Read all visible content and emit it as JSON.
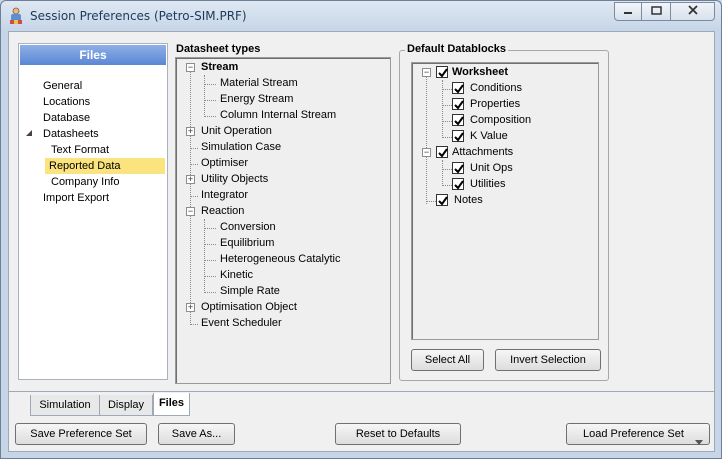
{
  "window": {
    "title": "Session Preferences (Petro-SIM.PRF)"
  },
  "nav": {
    "header": "Files",
    "items": [
      {
        "label": "General",
        "selected": false
      },
      {
        "label": "Locations",
        "selected": false
      },
      {
        "label": "Database",
        "selected": false
      },
      {
        "label": "Datasheets",
        "selected": false
      },
      {
        "label": "Text Format",
        "selected": false
      },
      {
        "label": "Reported Data",
        "selected": true
      },
      {
        "label": "Company Info",
        "selected": false
      },
      {
        "label": "Import Export",
        "selected": false
      }
    ]
  },
  "datasheet_types": {
    "label": "Datasheet types",
    "items": [
      {
        "label": "Stream",
        "bold": true,
        "expander": "−"
      },
      {
        "label": "Material Stream"
      },
      {
        "label": "Energy Stream"
      },
      {
        "label": "Column Internal Stream"
      },
      {
        "label": "Unit Operation",
        "expander": "+"
      },
      {
        "label": "Simulation Case"
      },
      {
        "label": "Optimiser"
      },
      {
        "label": "Utility Objects",
        "expander": "+"
      },
      {
        "label": "Integrator"
      },
      {
        "label": "Reaction",
        "expander": "−"
      },
      {
        "label": "Conversion"
      },
      {
        "label": "Equilibrium"
      },
      {
        "label": "Heterogeneous Catalytic"
      },
      {
        "label": "Kinetic"
      },
      {
        "label": "Simple Rate"
      },
      {
        "label": "Optimisation Object",
        "expander": "+"
      },
      {
        "label": "Event Scheduler"
      }
    ]
  },
  "default_datablocks": {
    "label": "Default Datablocks",
    "items": [
      {
        "label": "Worksheet",
        "bold": true,
        "checked": true
      },
      {
        "label": "Conditions",
        "checked": true
      },
      {
        "label": "Properties",
        "checked": true
      },
      {
        "label": "Composition",
        "checked": true
      },
      {
        "label": "K Value",
        "checked": true
      },
      {
        "label": "Attachments",
        "checked": true
      },
      {
        "label": "Unit Ops",
        "checked": true
      },
      {
        "label": "Utilities",
        "checked": true
      },
      {
        "label": "Notes",
        "checked": true
      }
    ],
    "select_all": "Select All",
    "invert_selection": "Invert Selection"
  },
  "tabs": [
    {
      "label": "Simulation",
      "active": false
    },
    {
      "label": "Display",
      "active": false
    },
    {
      "label": "Files",
      "active": true
    }
  ],
  "footer": {
    "save_preference_set": "Save Preference Set",
    "save_as": "Save As...",
    "reset_to_defaults": "Reset to Defaults",
    "load_preference_set": "Load Preference Set"
  },
  "colors": {
    "selected_bg": "#fbe47d",
    "nav_header_bg": "#5a86d5"
  }
}
